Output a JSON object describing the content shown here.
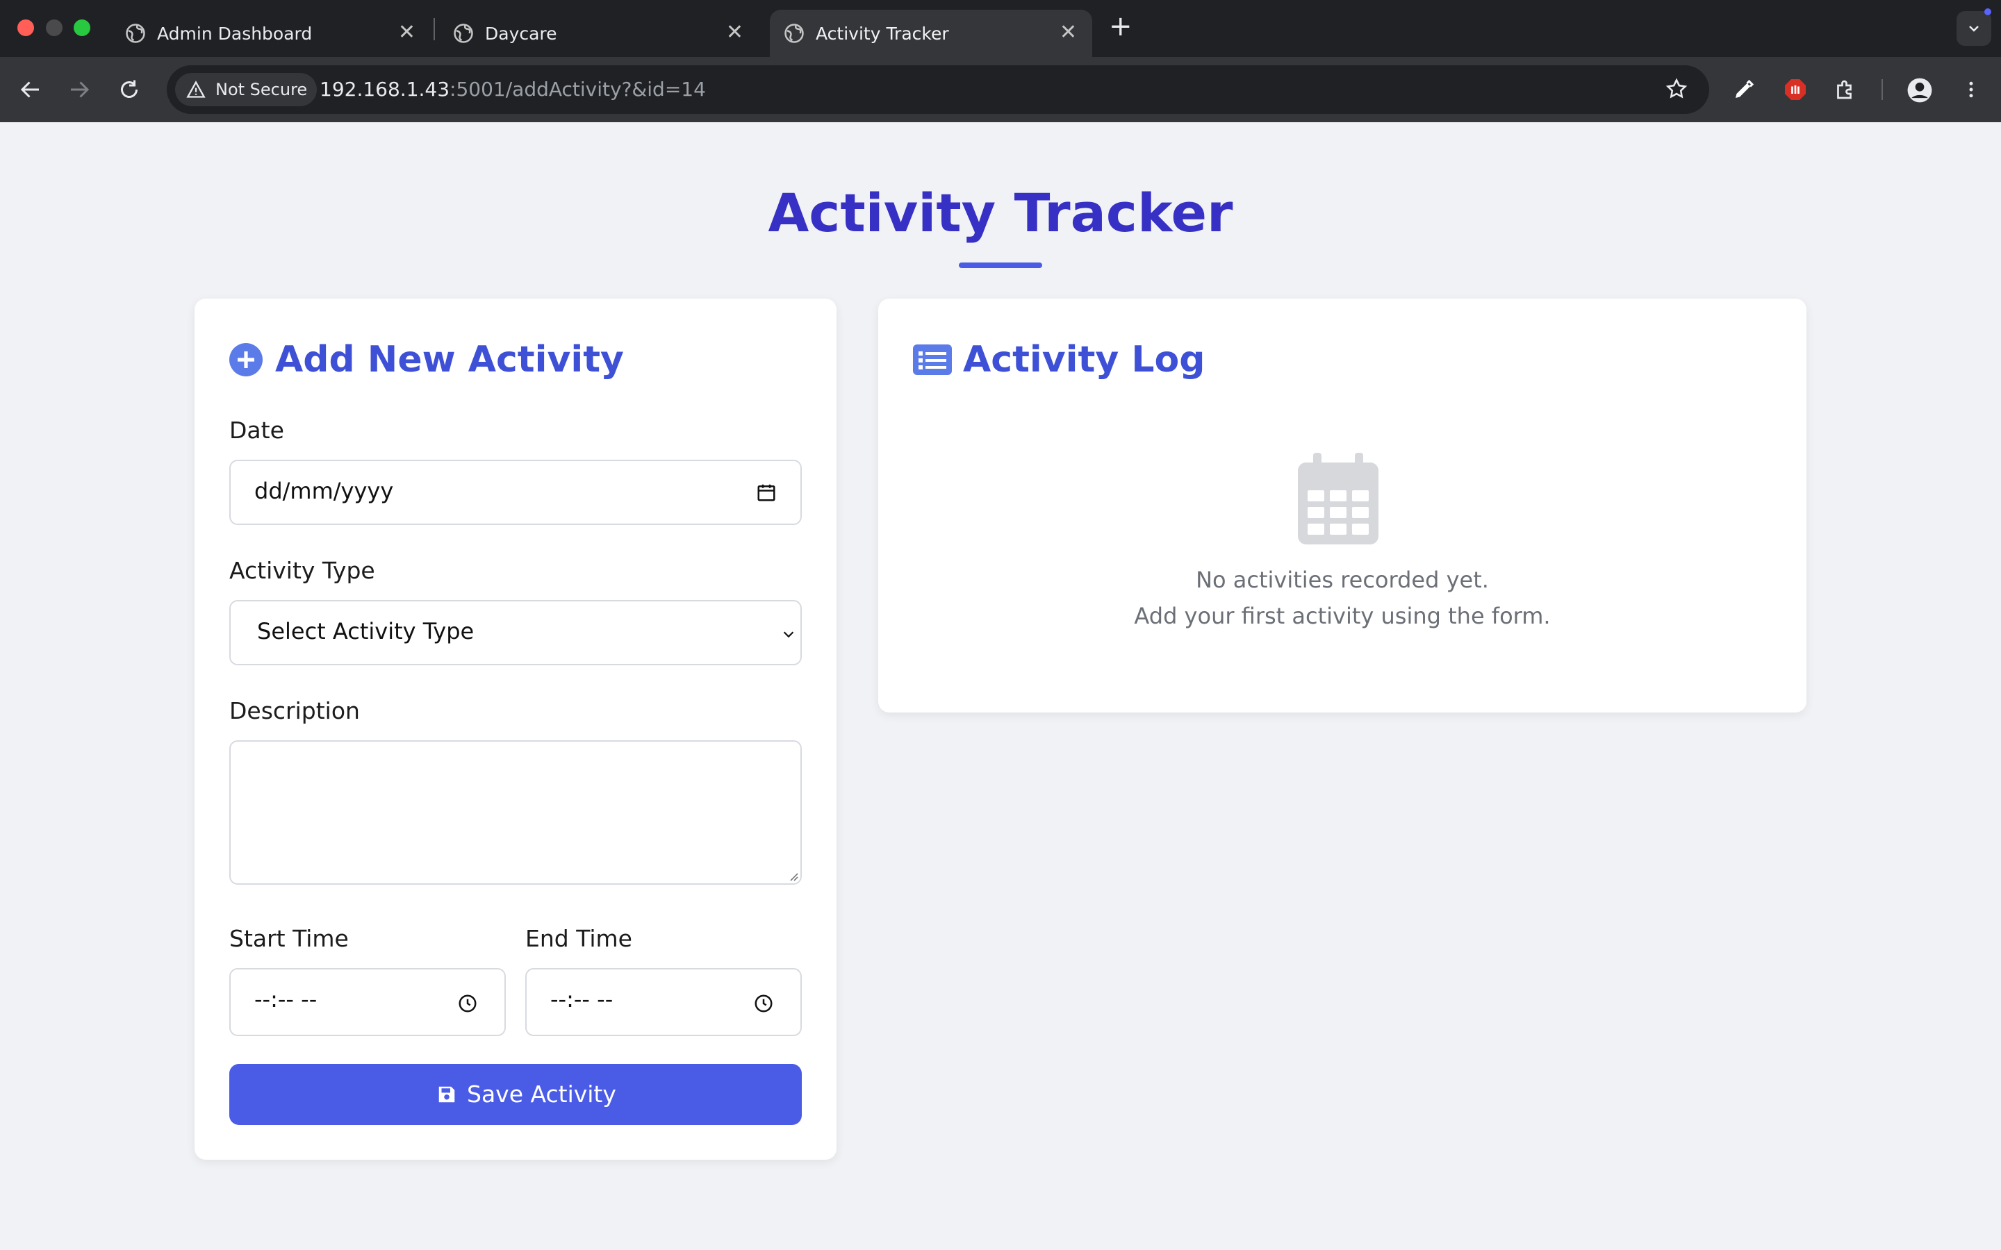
{
  "browser": {
    "tabs": [
      {
        "title": "Admin Dashboard",
        "active": false
      },
      {
        "title": "Daycare",
        "active": false
      },
      {
        "title": "Activity Tracker",
        "active": true
      }
    ],
    "security_label": "Not Secure",
    "url_host": "192.168.1.43",
    "url_path": ":5001/addActivity?&id=14"
  },
  "page": {
    "title": "Activity Tracker"
  },
  "form": {
    "heading": "Add New Activity",
    "date_label": "Date",
    "date_placeholder": "dd/mm/yyyy",
    "activity_type_label": "Activity Type",
    "activity_type_selected": "Select Activity Type",
    "description_label": "Description",
    "description_value": "",
    "start_time_label": "Start Time",
    "start_time_value": "--:-- --",
    "end_time_label": "End Time",
    "end_time_value": "--:-- --",
    "save_label": "Save Activity"
  },
  "log": {
    "heading": "Activity Log",
    "empty_line1": "No activities recorded yet.",
    "empty_line2": "Add your first activity using the form."
  },
  "colors": {
    "accent": "#4a5be6",
    "title": "#3730c4",
    "page_bg": "#f0f2f5"
  }
}
